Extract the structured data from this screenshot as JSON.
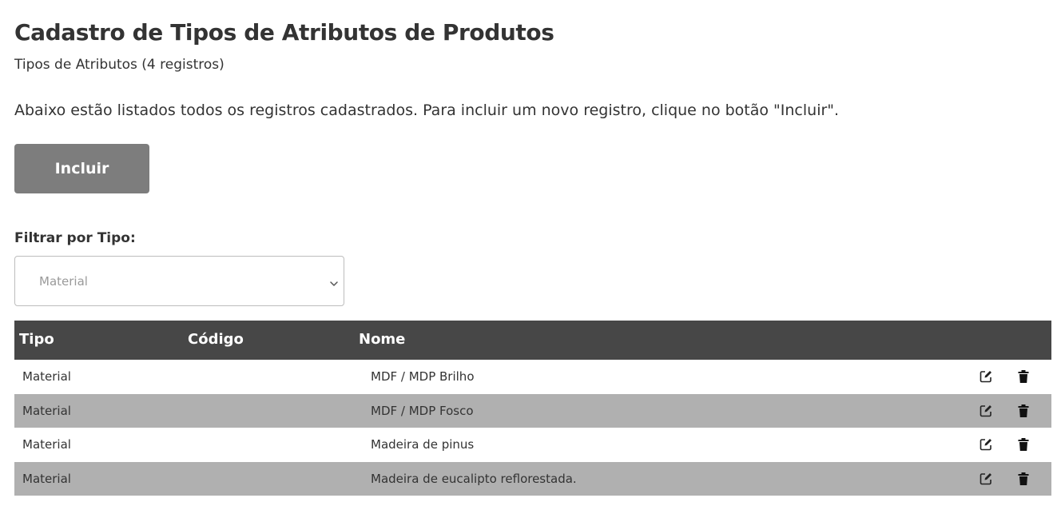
{
  "header": {
    "title": "Cadastro de Tipos de Atributos de Produtos",
    "subtitle": "Tipos de Atributos (4 registros)"
  },
  "intro_text": "Abaixo estão listados todos os registros cadastrados. Para incluir um novo registro, clique no botão \"Incluir\".",
  "actions": {
    "include_label": "Incluir"
  },
  "filter": {
    "label": "Filtrar por Tipo:",
    "selected": "Material"
  },
  "table": {
    "columns": {
      "tipo": "Tipo",
      "codigo": "Código",
      "nome": "Nome"
    },
    "rows": [
      {
        "tipo": "Material",
        "codigo": "",
        "nome": "MDF / MDP Brilho"
      },
      {
        "tipo": "Material",
        "codigo": "",
        "nome": "MDF / MDP Fosco"
      },
      {
        "tipo": "Material",
        "codigo": "",
        "nome": "Madeira de pinus"
      },
      {
        "tipo": "Material",
        "codigo": "",
        "nome": "Madeira de eucalipto reflorestada."
      }
    ],
    "row_actions": {
      "edit_icon": "edit-icon",
      "delete_icon": "trash-icon"
    }
  },
  "colors": {
    "header_bg": "#474747",
    "alt_row_bg": "#b0b0b0",
    "button_bg": "#7d7d7d",
    "text": "#333333"
  }
}
